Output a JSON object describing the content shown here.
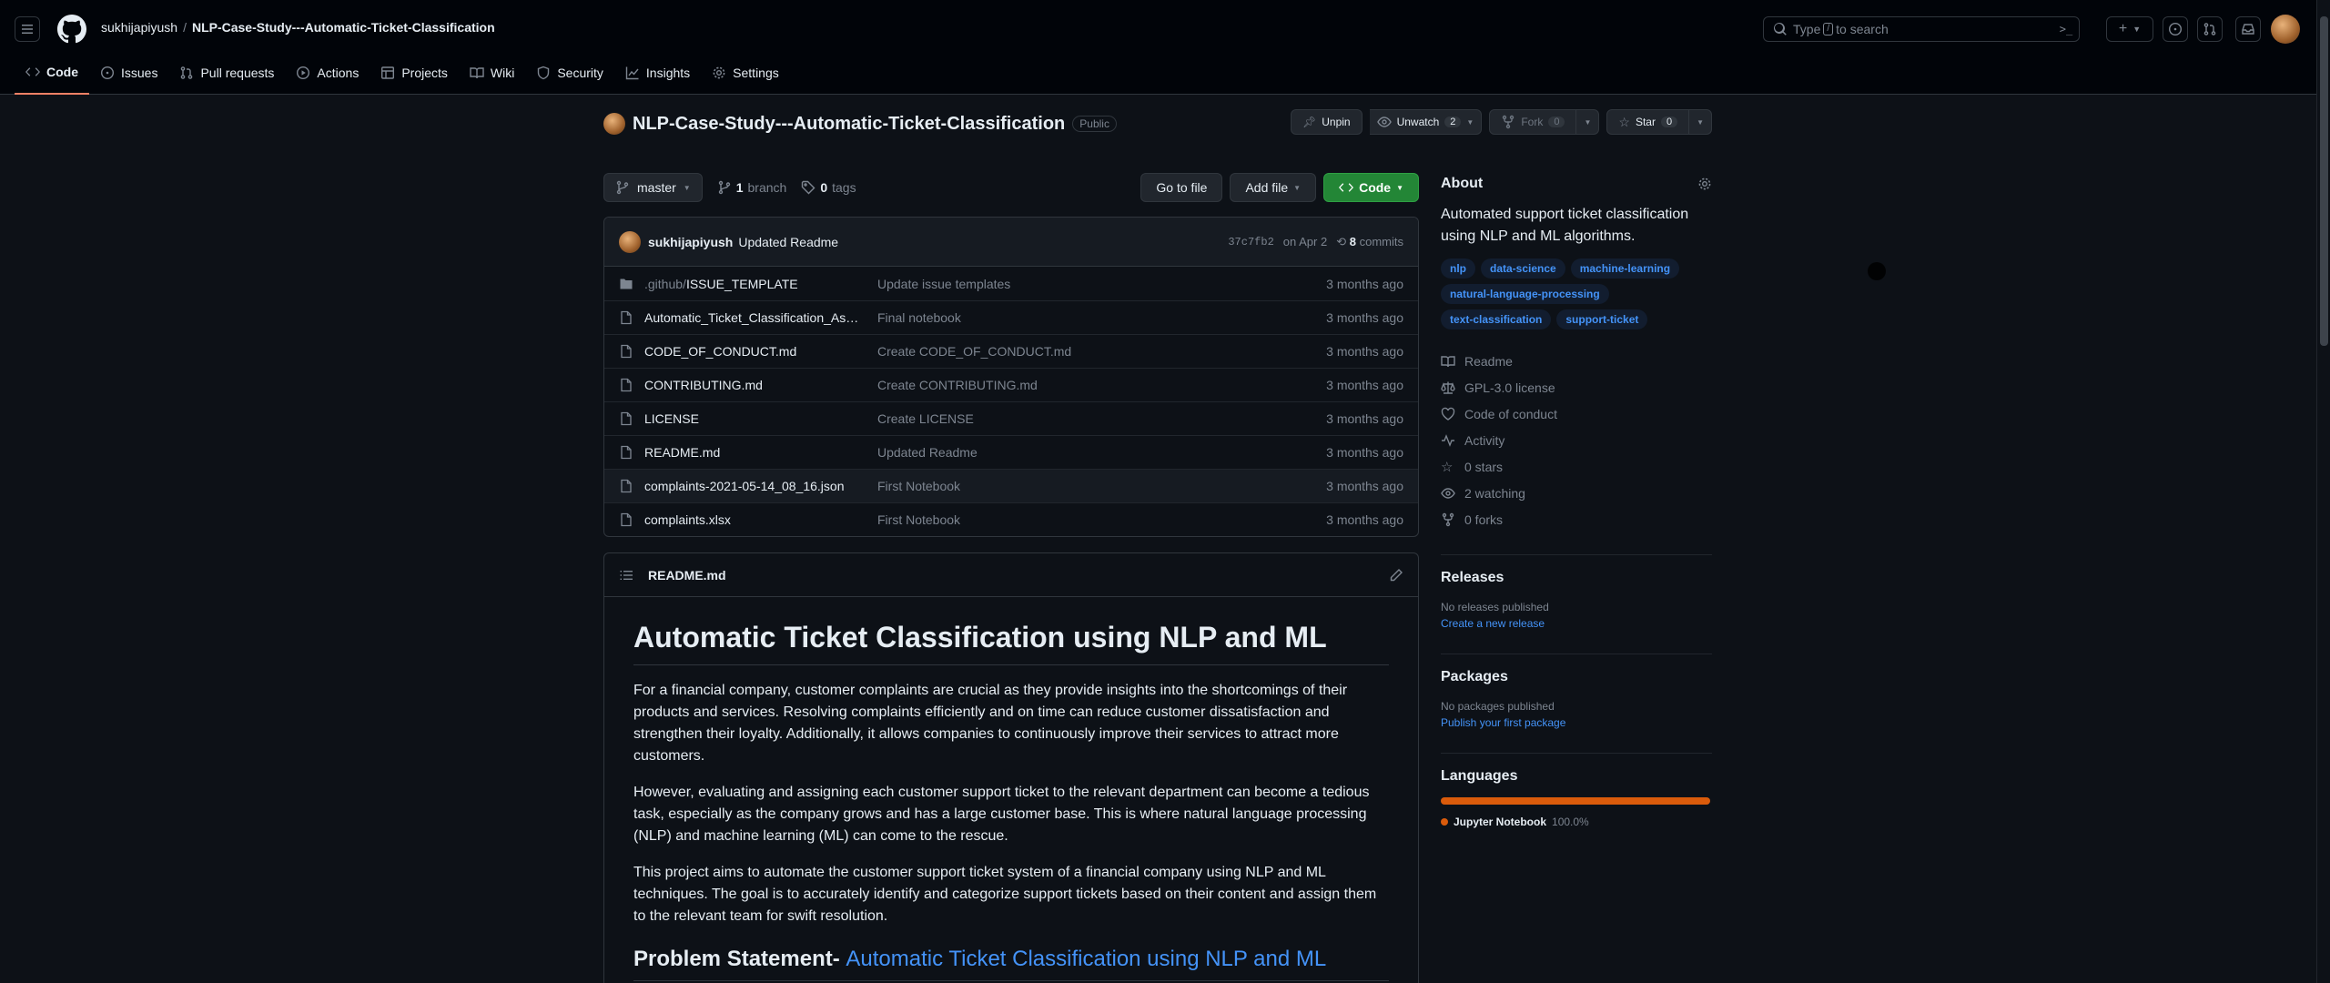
{
  "header": {
    "owner": "sukhijapiyush",
    "separator": "/",
    "repo": "NLP-Case-Study---Automatic-Ticket-Classification",
    "search_prefix": "Type",
    "search_key": "/",
    "search_suffix": "to search"
  },
  "nav": {
    "code": "Code",
    "issues": "Issues",
    "pulls": "Pull requests",
    "actions": "Actions",
    "projects": "Projects",
    "wiki": "Wiki",
    "security": "Security",
    "insights": "Insights",
    "settings": "Settings"
  },
  "repo": {
    "title": "NLP-Case-Study---Automatic-Ticket-Classification",
    "visibility": "Public",
    "unpin": "Unpin",
    "unwatch": "Unwatch",
    "watch_count": "2",
    "fork": "Fork",
    "fork_count": "0",
    "star": "Star",
    "star_count": "0"
  },
  "branch": {
    "name": "master",
    "branch_count": "1",
    "branch_label": "branch",
    "tag_count": "0",
    "tag_label": "tags",
    "go_to_file": "Go to file",
    "add_file": "Add file",
    "code": "Code"
  },
  "commit": {
    "user": "sukhijapiyush",
    "message": "Updated Readme",
    "sha": "37c7fb2",
    "date": "on Apr 2",
    "count": "8",
    "count_label": "commits"
  },
  "files": [
    {
      "dir": ".github/",
      "name": "ISSUE_TEMPLATE",
      "msg": "Update issue templates",
      "age": "3 months ago",
      "type": "folder"
    },
    {
      "dir": "",
      "name": "Automatic_Ticket_Classification_Assig...",
      "msg": "Final notebook",
      "age": "3 months ago",
      "type": "file"
    },
    {
      "dir": "",
      "name": "CODE_OF_CONDUCT.md",
      "msg": "Create CODE_OF_CONDUCT.md",
      "age": "3 months ago",
      "type": "file"
    },
    {
      "dir": "",
      "name": "CONTRIBUTING.md",
      "msg": "Create CONTRIBUTING.md",
      "age": "3 months ago",
      "type": "file"
    },
    {
      "dir": "",
      "name": "LICENSE",
      "msg": "Create LICENSE",
      "age": "3 months ago",
      "type": "file"
    },
    {
      "dir": "",
      "name": "README.md",
      "msg": "Updated Readme",
      "age": "3 months ago",
      "type": "file"
    },
    {
      "dir": "",
      "name": "complaints-2021-05-14_08_16.json",
      "msg": "First Notebook",
      "age": "3 months ago",
      "type": "file"
    },
    {
      "dir": "",
      "name": "complaints.xlsx",
      "msg": "First Notebook",
      "age": "3 months ago",
      "type": "file"
    }
  ],
  "readme": {
    "filename": "README.md",
    "h1": "Automatic Ticket Classification using NLP and ML",
    "p1": "For a financial company, customer complaints are crucial as they provide insights into the shortcomings of their products and services. Resolving complaints efficiently and on time can reduce customer dissatisfaction and strengthen their loyalty. Additionally, it allows companies to continuously improve their services to attract more customers.",
    "p2": "However, evaluating and assigning each customer support ticket to the relevant department can become a tedious task, especially as the company grows and has a large customer base. This is where natural language processing (NLP) and machine learning (ML) can come to the rescue.",
    "p3": "This project aims to automate the customer support ticket system of a financial company using NLP and ML techniques. The goal is to accurately identify and categorize support tickets based on their content and assign them to the relevant team for swift resolution.",
    "h2_prefix": "Problem Statement-",
    "h2_link": "Automatic Ticket Classification using NLP and ML"
  },
  "about": {
    "title": "About",
    "description": "Automated support ticket classification using NLP and ML algorithms.",
    "topics": [
      "nlp",
      "data-science",
      "machine-learning",
      "natural-language-processing",
      "text-classification",
      "support-ticket"
    ],
    "readme": "Readme",
    "license": "GPL-3.0 license",
    "conduct": "Code of conduct",
    "activity": "Activity",
    "stars": "0 stars",
    "watching": "2 watching",
    "forks": "0 forks"
  },
  "releases": {
    "title": "Releases",
    "none": "No releases published",
    "create": "Create a new release"
  },
  "packages": {
    "title": "Packages",
    "none": "No packages published",
    "publish": "Publish your first package"
  },
  "languages": {
    "title": "Languages",
    "items": [
      {
        "name": "Jupyter Notebook",
        "pct": "100.0%",
        "color": "#da5b0b",
        "fraction": 1.0
      }
    ]
  },
  "colors": {
    "bg": "#0d1117",
    "header_bg": "#010409",
    "link": "#4493f8",
    "green_button": "#238636",
    "active_tab": "#f78166"
  }
}
